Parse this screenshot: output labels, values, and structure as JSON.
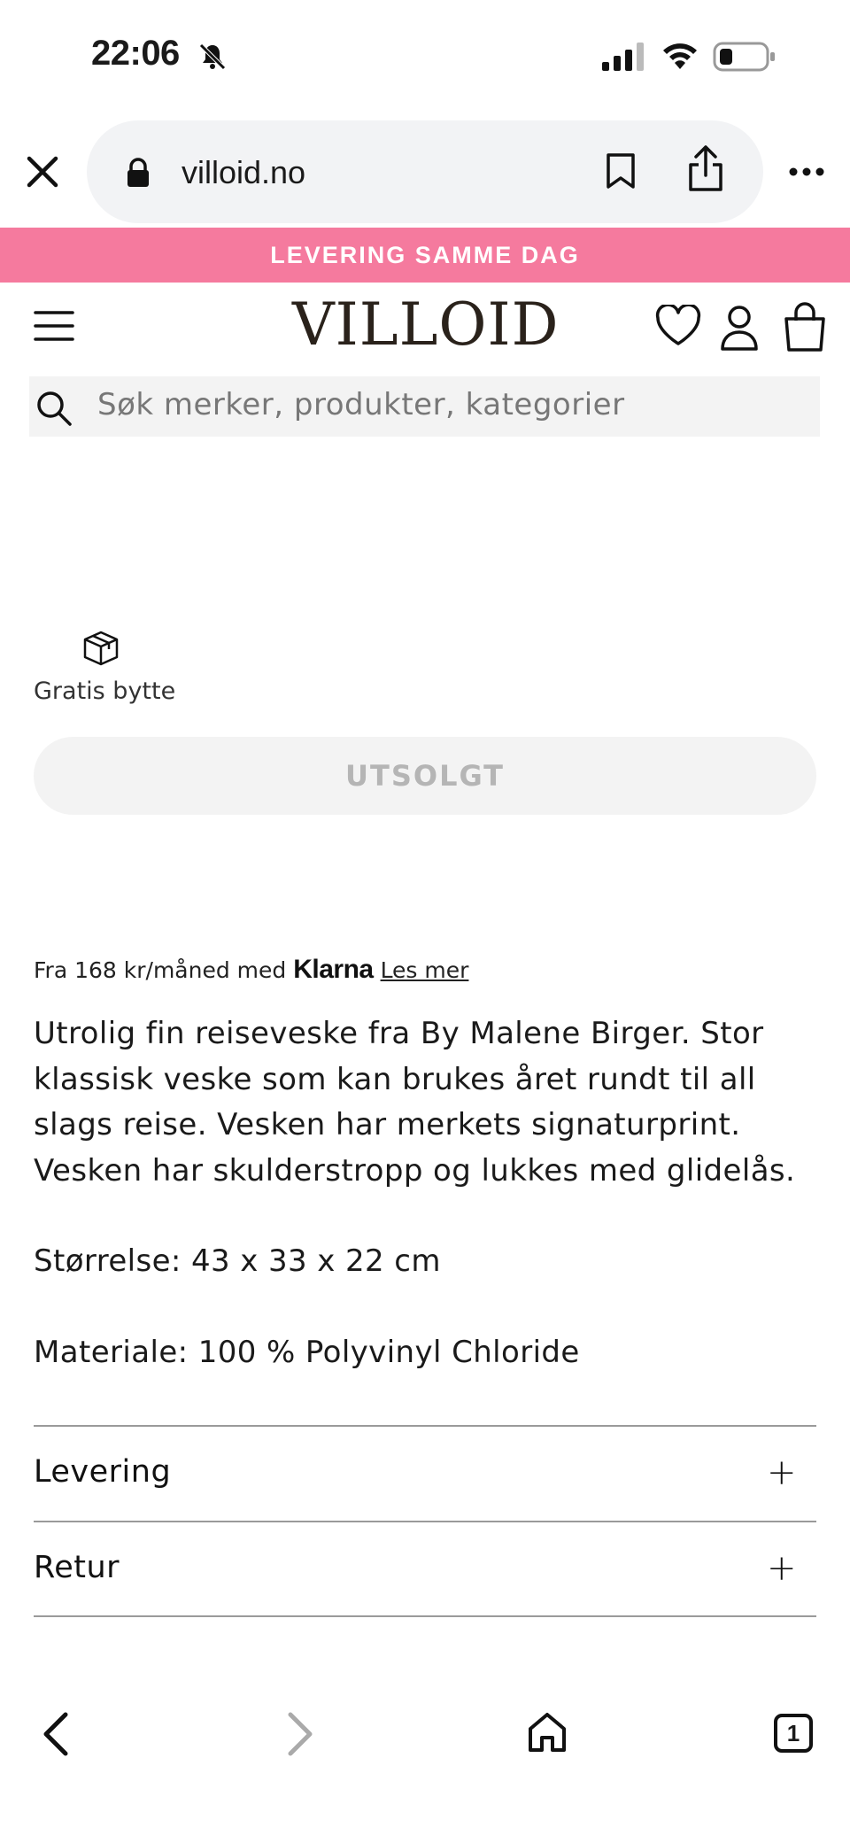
{
  "status_bar": {
    "time": "22:06"
  },
  "browser": {
    "url": "villoid.no"
  },
  "banner": {
    "text": "LEVERING SAMME DAG"
  },
  "header": {
    "logo": "VILLOID"
  },
  "search": {
    "placeholder": "Søk merker, produkter, kategorier"
  },
  "product": {
    "perk": "Gratis bytte",
    "soldout_label": "UTSOLGT",
    "klarna": {
      "prefix": "Fra 168 kr/måned med",
      "brand": "Klarna",
      "link": "Les mer"
    },
    "description": "Utrolig fin reiseveske fra By Malene Birger. Stor klassisk veske som kan brukes året rundt til all slags reise. Vesken har merkets signaturprint. Vesken har skulderstropp og lukkes med glidelås.",
    "size": "Størrelse: 43 x 33 x 22 cm",
    "material": "Materiale: 100 % Polyvinyl Chloride"
  },
  "accordion": [
    {
      "label": "Levering",
      "icon": "+"
    },
    {
      "label": "Retur",
      "icon": "+"
    }
  ],
  "toolbar": {
    "tab_count": "1"
  }
}
